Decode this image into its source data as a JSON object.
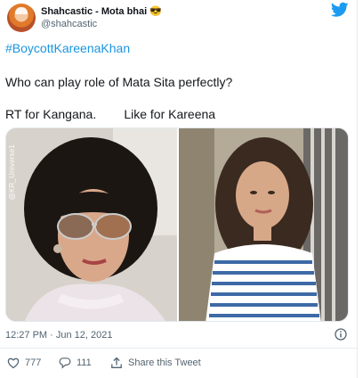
{
  "tweet": {
    "author_name": "Shahcastic - Mota bhai",
    "author_emoji": "😎",
    "author_handle": "@shahcastic",
    "hashtag": "#BoycottKareenaKhan",
    "line1": "Who can play role of Mata Sita perfectly?",
    "line2": "RT for Kangana.        Like for Kareena",
    "media": {
      "watermark": "@KR_Universe1"
    },
    "timestamp": "12:27 PM · Jun 12, 2021",
    "actions": {
      "like_count": "777",
      "reply_count": "111",
      "share_label": "Share this Tweet"
    }
  },
  "colors": {
    "twitter_blue": "#1d9bf0",
    "hashtag_blue": "#1b95e0",
    "muted": "#536471"
  },
  "icons": {
    "brand": "twitter-bird-icon",
    "info": "info-icon",
    "like": "heart-icon",
    "reply": "reply-icon",
    "share": "share-icon"
  }
}
